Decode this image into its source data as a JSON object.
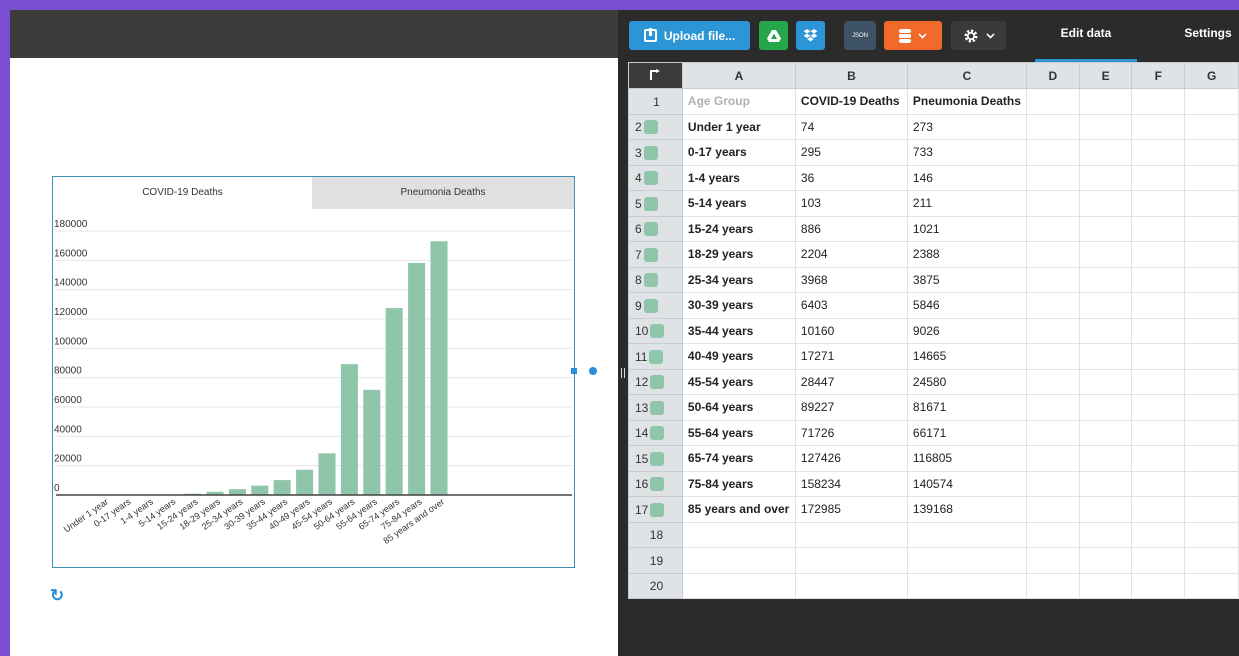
{
  "toolbar": {
    "upload_label": "Upload file...",
    "json_label": "JSON",
    "tab_edit": "Edit data",
    "tab_settings": "Settings"
  },
  "colors": {
    "bar": "#8fc5a8",
    "accent": "#2b95d6",
    "background": "#7a4fd0"
  },
  "chart_tabs": [
    "COVID-19 Deaths",
    "Pneumonia Deaths"
  ],
  "sheet": {
    "columns": [
      "A",
      "B",
      "C",
      "D",
      "E",
      "F",
      "G"
    ],
    "rows": [
      [
        "Age Group",
        "COVID-19 Deaths",
        "Pneumonia Deaths"
      ],
      [
        "Under 1 year",
        "74",
        "273"
      ],
      [
        "0-17 years",
        "295",
        "733"
      ],
      [
        "1-4 years",
        "36",
        "146"
      ],
      [
        "5-14 years",
        "103",
        "211"
      ],
      [
        "15-24 years",
        "886",
        "1021"
      ],
      [
        "18-29 years",
        "2204",
        "2388"
      ],
      [
        "25-34 years",
        "3968",
        "3875"
      ],
      [
        "30-39 years",
        "6403",
        "5846"
      ],
      [
        "35-44 years",
        "10160",
        "9026"
      ],
      [
        "40-49 years",
        "17271",
        "14665"
      ],
      [
        "45-54 years",
        "28447",
        "24580"
      ],
      [
        "50-64 years",
        "89227",
        "81671"
      ],
      [
        "55-64 years",
        "71726",
        "66171"
      ],
      [
        "65-74 years",
        "127426",
        "116805"
      ],
      [
        "75-84 years",
        "158234",
        "140574"
      ],
      [
        "85 years and over",
        "172985",
        "139168"
      ],
      [
        "",
        "",
        ""
      ],
      [
        "",
        "",
        ""
      ],
      [
        "",
        "",
        ""
      ]
    ]
  },
  "chart_data": {
    "type": "bar",
    "title": "",
    "categories": [
      "Under 1 year",
      "0-17 years",
      "1-4 years",
      "5-14 years",
      "15-24 years",
      "18-29 years",
      "25-34 years",
      "30-39 years",
      "35-44 years",
      "40-49 years",
      "45-54 years",
      "50-64 years",
      "55-64 years",
      "65-74 years",
      "75-84 years",
      "85 years and over"
    ],
    "series": [
      {
        "name": "COVID-19 Deaths",
        "values": [
          74,
          295,
          36,
          103,
          886,
          2204,
          3968,
          6403,
          10160,
          17271,
          28447,
          89227,
          71726,
          127426,
          158234,
          172985
        ]
      }
    ],
    "yticks": [
      "0",
      "20000",
      "40000",
      "60000",
      "80000",
      "100000",
      "120000",
      "140000",
      "160000",
      "180000"
    ],
    "ylim": [
      0,
      180000
    ],
    "grid": true
  }
}
